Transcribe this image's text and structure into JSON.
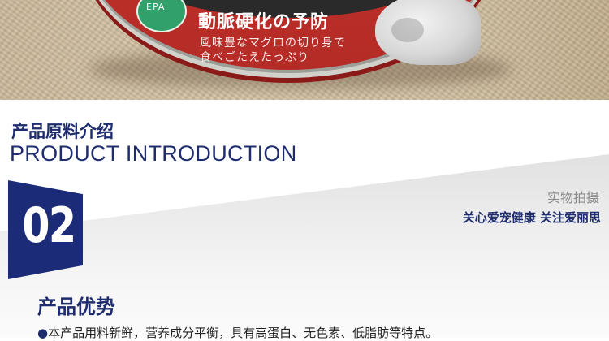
{
  "photo": {
    "badge_text": "EPA",
    "title_jp": "動脈硬化の予防",
    "desc_jp_line1": "風味豊なマグロの切り身で",
    "desc_jp_line2": "食べごたえたっぷり"
  },
  "section": {
    "title_zh": "产品原料介绍",
    "title_en": "PRODUCT INTRODUCTION"
  },
  "badge": {
    "number": "02"
  },
  "captions": {
    "real_photo": "实物拍摄",
    "slogan": "关心爱宠健康 关注爱丽思"
  },
  "advantages": {
    "title": "产品优势",
    "bullet": "●",
    "point1": "本产品用料新鲜，营养成分平衡，具有高蛋白、无色素、低脂肪等特点。"
  },
  "colors": {
    "brand_navy": "#1f2d6e",
    "badge_navy": "#1b2b78",
    "can_red": "#c0312b",
    "epa_green": "#31a06a"
  }
}
